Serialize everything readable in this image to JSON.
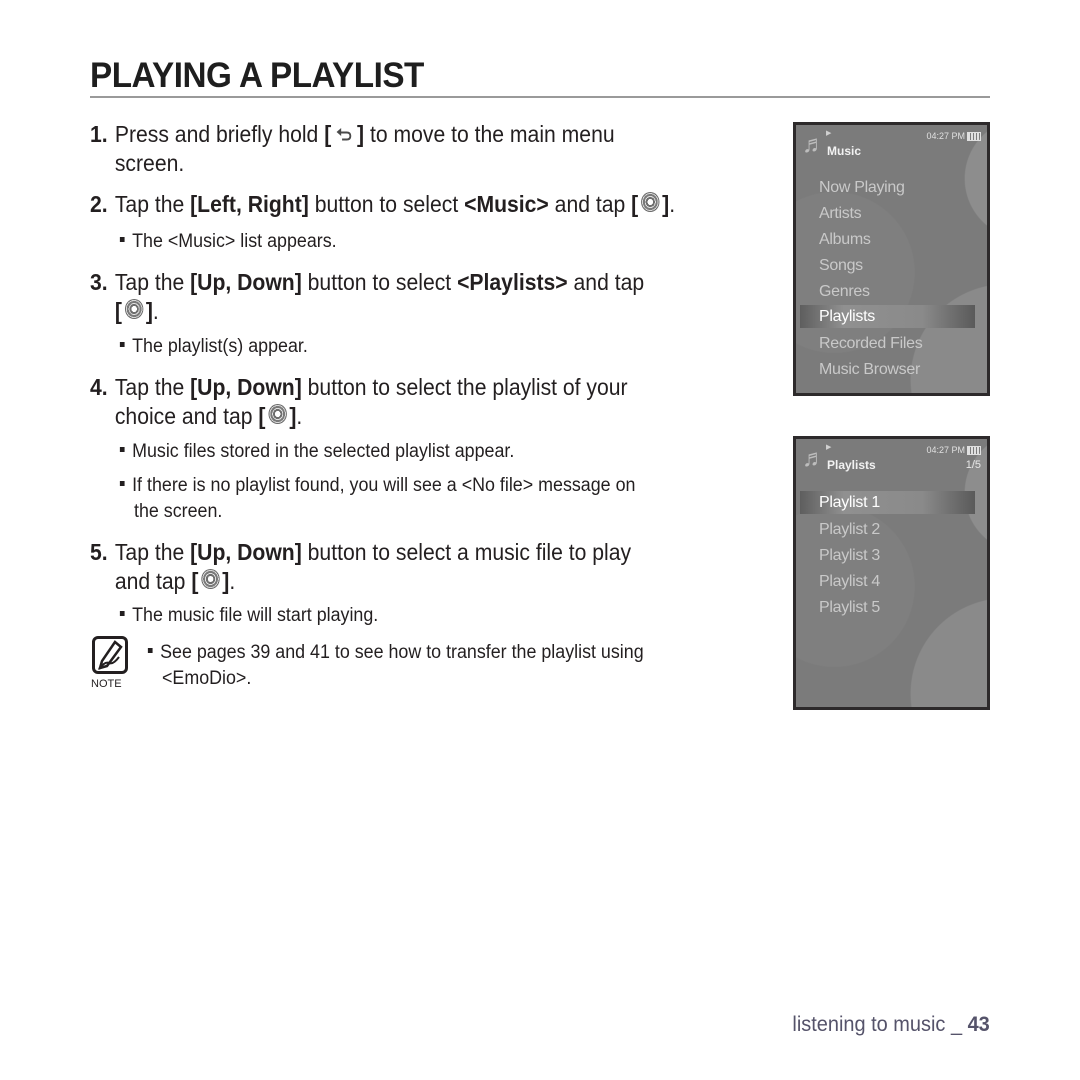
{
  "page": {
    "title": "PLAYING A PLAYLIST",
    "footer": {
      "section": "listening to music _ ",
      "page_number": "43"
    }
  },
  "steps": [
    {
      "num": "1.",
      "parts": [
        "Press and briefly hold ",
        "[",
        "]",
        " to move to the main menu"
      ],
      "cont": "screen.",
      "icon": "back-arrow-icon"
    },
    {
      "num": "2.",
      "pre": "Tap the ",
      "bold1": "[Left, Right]",
      "mid": " button to select ",
      "bold2": "<Music>",
      "post": " and tap ",
      "bullets": [
        "The <Music> list appears."
      ]
    },
    {
      "num": "3.",
      "pre": "Tap the ",
      "bold1": "[Up, Down]",
      "mid": " button to select ",
      "bold2": "<Playlists>",
      "post": " and tap",
      "bullets": [
        "The playlist(s) appear."
      ]
    },
    {
      "num": "4.",
      "pre": "Tap the ",
      "bold1": "[Up, Down]",
      "mid": " button to select the playlist of your",
      "cont": "choice and tap ",
      "bullets": [
        "Music files stored in the selected playlist appear.",
        "If there is no playlist found, you will see a <No file> message on",
        "the screen."
      ]
    },
    {
      "num": "5.",
      "pre": "Tap the ",
      "bold1": "[Up, Down]",
      "mid": " button to select a music file to play",
      "cont": "and tap ",
      "bullets": [
        "The music file will start playing."
      ]
    }
  ],
  "brackets": {
    "open": "[",
    "close": "]",
    "period": "."
  },
  "note": {
    "label": "NOTE",
    "line1": "See pages 39 and 41 to see how to transfer the playlist using",
    "line2": "<EmoDio>."
  },
  "screens": [
    {
      "title": "Music",
      "time": "04:27 PM",
      "items": [
        "Now Playing",
        "Artists",
        "Albums",
        "Songs",
        "Genres",
        "Playlists",
        "Recorded Files",
        "Music Browser"
      ],
      "selected_index": 5
    },
    {
      "title": "Playlists",
      "time": "04:27 PM",
      "count": "1/5",
      "items": [
        "Playlist 1",
        "Playlist 2",
        "Playlist 3",
        "Playlist 4",
        "Playlist 5"
      ],
      "selected_index": 0
    }
  ]
}
